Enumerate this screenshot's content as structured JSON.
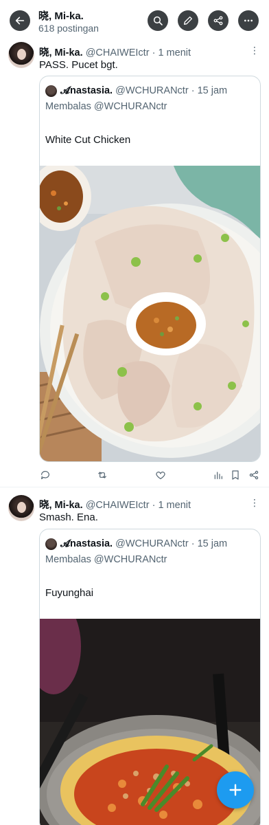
{
  "header": {
    "title": "晓, Mi-ka.",
    "subtitle": "618 postingan",
    "icons": [
      "back-arrow-icon",
      "search-icon",
      "edit-icon",
      "share-icon",
      "more-icon"
    ]
  },
  "tweets": [
    {
      "name": "晓, Mi-ka.",
      "handle": "@CHAIWEIctr",
      "dot": "·",
      "time": "1 menit",
      "text": "PASS. Pucet bgt.",
      "quote": {
        "name": "𝓐nastasia.",
        "handle": "@WCHURANctr",
        "dot": "·",
        "time": "15 jam",
        "reply_prefix": "Membalas",
        "reply_mention": "@WCHURANctr",
        "text": "White Cut Chicken"
      }
    },
    {
      "name": "晓, Mi-ka.",
      "handle": "@CHAIWEIctr",
      "dot": "·",
      "time": "1 menit",
      "text": "Smash. Ena.",
      "quote": {
        "name": "𝓐nastasia.",
        "handle": "@WCHURANctr",
        "dot": "·",
        "time": "15 jam",
        "reply_prefix": "Membalas",
        "reply_mention": "@WCHURANctr",
        "text": "Fuyunghai"
      }
    }
  ],
  "colors": {
    "accent": "#1d9bf0",
    "text": "#0f1419",
    "muted": "#536471",
    "border": "#cfd9de"
  },
  "fab": {
    "icon": "plus-icon"
  }
}
